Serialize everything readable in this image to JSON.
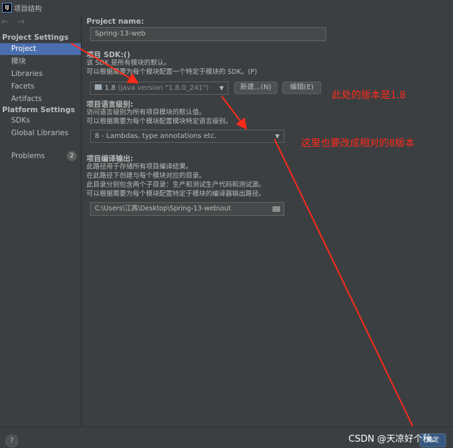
{
  "window": {
    "title": "项目结构",
    "app_icon_text": "IJ"
  },
  "sidebar": {
    "nav_arrows": "← →",
    "project_settings_heading": "Project Settings",
    "project_items": [
      "Project",
      "模块",
      "Libraries",
      "Facets",
      "Artifacts"
    ],
    "platform_settings_heading": "Platform Settings",
    "platform_items": [
      "SDKs",
      "Global Libraries"
    ],
    "problems_label": "Problems",
    "problems_count": "2",
    "selected": "Project"
  },
  "main": {
    "project_name_label": "Project name:",
    "project_name_value": "Spring-13-web",
    "sdk_label": "项目 SDK:()",
    "sdk_desc_1": "该 SDK 是所有模块的默认。",
    "sdk_desc_2": "可以根据需要为每个模块配置一个特定于模块的 SDK。(P)",
    "sdk_selected": "1.8",
    "sdk_selected_detail": "(java version \"1.8.0_241\")",
    "sdk_new_button": "新建...(N)",
    "sdk_edit_button": "编辑(E)",
    "lang_level_label": "项目语言级别:",
    "lang_desc_1": "访问语言级别为所有项目模块的默认值。",
    "lang_desc_2": "可以根据需要为每个模块配置模块特定语言级别。",
    "lang_level_selected": "8 - Lambdas, type annotations etc.",
    "output_label": "项目编译输出:",
    "output_desc_1": "此路径用于存储所有项目编译结果。",
    "output_desc_2": "在此路径下创建与每个模块对应的目录。",
    "output_desc_3": "此目录分别包含两个子目录：生产和测试生产代码和测试源。",
    "output_desc_4": "可以根据需要为每个模块配置特定于模块的编译器输出路径。",
    "output_path": "C:\\Users\\江茜\\Desktop\\Spring-13-web\\out"
  },
  "annotations": {
    "note_sdk": "此处的版本是1.8",
    "note_lang": "这里也要改成相对的8版本",
    "color": "#ff2a1a"
  },
  "footer": {
    "help_label": "?",
    "ok_button": "确定",
    "watermark": "CSDN @天凉好个秋."
  }
}
